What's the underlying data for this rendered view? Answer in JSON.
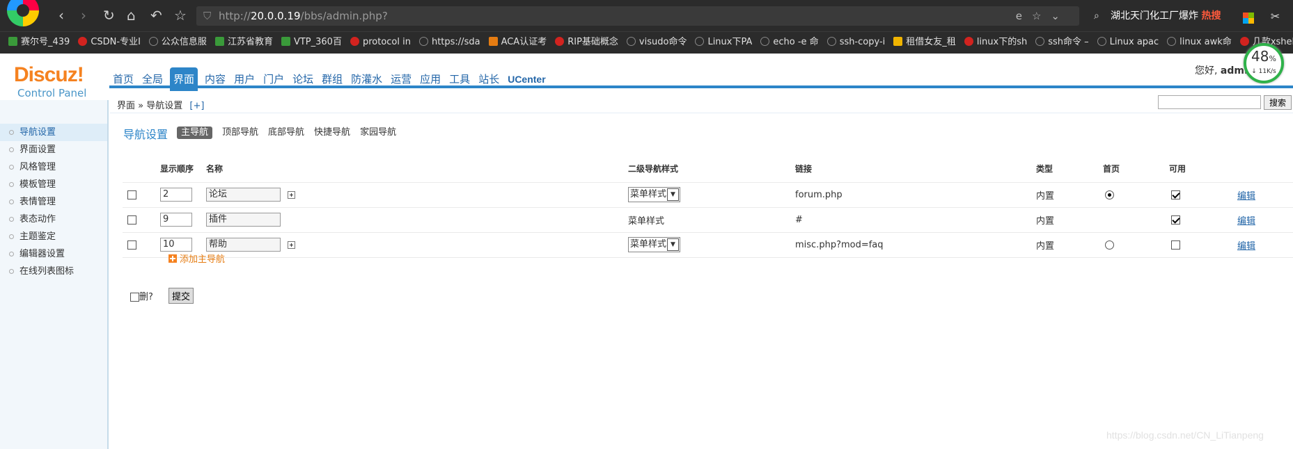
{
  "browser": {
    "address": {
      "scheme": "http://",
      "host": "20.0.0.19",
      "path": "/bbs/admin.php?"
    },
    "search_text": "湖北天门化工厂爆炸",
    "search_badge": "热搜",
    "bookmarks": [
      "赛尔号_439",
      "CSDN-专业I",
      "公众信息服",
      "江苏省教育",
      "VTP_360百",
      "protocol in",
      "https://sda",
      "ACA认证考",
      "RIP基础概念",
      "visudo命令",
      "Linux下PA",
      "echo -e 命",
      "ssh-copy-i",
      "租借女友_租",
      "linux下的sh",
      "ssh命令 –",
      "Linux apac",
      "linux awk命",
      "几款xshel"
    ]
  },
  "speed_widget": {
    "percent": "48",
    "percent_sign": "%",
    "rate": "↓ 11K/s"
  },
  "header": {
    "logo": "Discuz!",
    "logo_sub": "Control Panel",
    "greeting": "您好,",
    "user": "admin",
    "nav": [
      "首页",
      "全局",
      "界面",
      "内容",
      "用户",
      "门户",
      "论坛",
      "群组",
      "防灌水",
      "运营",
      "应用",
      "工具",
      "站长",
      "UCenter"
    ],
    "active_nav": "界面"
  },
  "sidebar": {
    "items": [
      "导航设置",
      "界面设置",
      "风格管理",
      "模板管理",
      "表情管理",
      "表态动作",
      "主题鉴定",
      "编辑器设置",
      "在线列表图标"
    ],
    "active": "导航设置"
  },
  "breadcrumb": {
    "root": "界面",
    "sep": "»",
    "current": "导航设置",
    "plus": "[+]",
    "search_button": "搜索"
  },
  "main": {
    "title": "导航设置",
    "tabs": [
      "主导航",
      "顶部导航",
      "底部导航",
      "快捷导航",
      "家园导航"
    ],
    "active_tab": "主导航",
    "columns": [
      "显示顺序",
      "名称",
      "二级导航样式",
      "链接",
      "类型",
      "首页",
      "可用"
    ],
    "rows": [
      {
        "order": "2",
        "name": "论坛",
        "style": "菜单样式",
        "link": "forum.php",
        "type": "内置",
        "home": true,
        "enabled": true,
        "edit": "编辑"
      },
      {
        "order": "9",
        "name": "插件",
        "style": "菜单样式",
        "link": "#",
        "type": "内置",
        "home": null,
        "enabled": true,
        "edit": "编辑"
      },
      {
        "order": "10",
        "name": "帮助",
        "style": "菜单样式",
        "link": "misc.php?mod=faq",
        "type": "内置",
        "home": false,
        "enabled": false,
        "edit": "编辑"
      }
    ],
    "add_label": "添加主导航",
    "delete_label": "删?",
    "submit_label": "提交"
  },
  "watermark": "https://blog.csdn.net/CN_LiTianpeng"
}
